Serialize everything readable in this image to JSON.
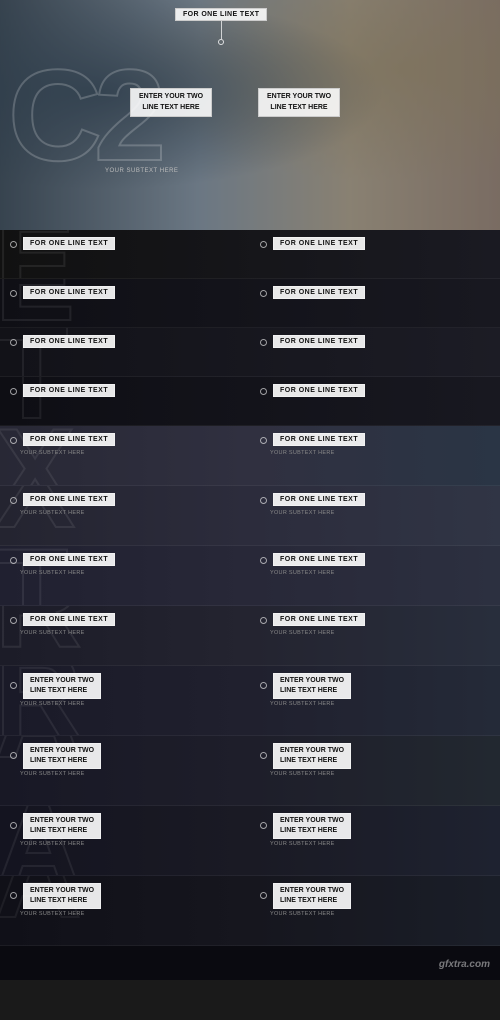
{
  "hero": {
    "top_anno": "FOR ONE LINE TEXT",
    "anno2_line1": "ENTER YOUR TWO",
    "anno2_line2": "LINE TEXT HERE",
    "anno3_line1": "ENTER YOUR TWO",
    "anno3_line2": "LINE TEXT HERE",
    "sub1": "YOUR SUBTEXT HERE",
    "big_letters": "C2"
  },
  "rows": [
    {
      "id": "row1",
      "left": {
        "title": "FOR ONE LINE TEXT",
        "style": "simple",
        "dot": true
      },
      "right": {
        "title": "FOR ONE LINE TEXT",
        "style": "simple",
        "dot": true
      }
    },
    {
      "id": "row2",
      "left": {
        "title": "FOR ONE LINE TEXT",
        "style": "simple",
        "dot": true
      },
      "right": {
        "title": "FOR ONE LINE TEXT",
        "style": "simple",
        "dot": true
      }
    },
    {
      "id": "row3",
      "left": {
        "title": "FOR ONE LINE TEXT",
        "style": "simple",
        "dot": true
      },
      "right": {
        "title": "FOR ONE LINE TEXT",
        "style": "simple",
        "dot": true
      }
    },
    {
      "id": "row4",
      "left": {
        "title": "FOR ONE LINE TEXT",
        "style": "simple",
        "dot": true
      },
      "right": {
        "title": "FOR ONE LINE TEXT",
        "style": "simple",
        "dot": true
      }
    },
    {
      "id": "row5",
      "left": {
        "title": "FOR ONE LINE TEXT",
        "sub": "YOUR SUBTEXT HERE",
        "style": "with-sub",
        "dot": true
      },
      "right": {
        "title": "FOR ONE LINE TEXT",
        "sub": "YOUR SUBTEXT HERE",
        "style": "with-sub",
        "dot": true
      }
    },
    {
      "id": "row6",
      "left": {
        "title": "FOR ONE LINE TEXT",
        "sub": "YOUR SUBTEXT HERE",
        "style": "with-sub",
        "dot": true
      },
      "right": {
        "title": "FOR ONE LINE TEXT",
        "sub": "YOUR SUBTEXT HERE",
        "style": "with-sub",
        "dot": true
      }
    },
    {
      "id": "row7",
      "left": {
        "title": "FOR ONE LINE TEXT",
        "sub": "YOUR SUBTEXT HERE",
        "style": "with-sub",
        "dot": true
      },
      "right": {
        "title": "FOR ONE LINE TEXT",
        "sub": "YOUR SUBTEXT HERE",
        "style": "with-sub",
        "dot": true
      }
    },
    {
      "id": "row8",
      "left": {
        "title": "FOR ONE LINE TEXT",
        "sub": "YOUR SUBTEXT HERE",
        "style": "with-sub",
        "dot": true
      },
      "right": {
        "title": "FOR ONE LINE TEXT",
        "sub": "YOUR SUBTEXT HERE",
        "style": "with-sub",
        "dot": true
      }
    },
    {
      "id": "row9",
      "left": {
        "line1": "ENTER YOUR TWO",
        "line2": "LINE TEXT HERE",
        "sub": "YOUR SUBTEXT HERE",
        "style": "two-line",
        "dot": true
      },
      "right": {
        "line1": "ENTER YOUR TWO",
        "line2": "LINE TEXT HERE",
        "sub": "YOUR SUBTEXT HERE",
        "style": "two-line",
        "dot": true
      }
    },
    {
      "id": "row10",
      "left": {
        "line1": "ENTER YOUR TWO",
        "line2": "LINE TEXT HERE",
        "sub": "YOUR SUBTEXT HERE",
        "style": "two-line",
        "dot": true
      },
      "right": {
        "line1": "ENTER YOUR TWO",
        "line2": "LINE TEXT HERE",
        "sub": "YOUR SUBTEXT HERE",
        "style": "two-line",
        "dot": true
      }
    },
    {
      "id": "row11",
      "left": {
        "line1": "ENTER YOUR TWO",
        "line2": "LINE TEXT HERE",
        "sub": "YOUR SUBTEXT HERE",
        "style": "two-line",
        "dot": true
      },
      "right": {
        "line1": "ENTER YOUR TWO",
        "line2": "LINE TEXT HERE",
        "sub": "YOUR SUBTEXT HERE",
        "style": "two-line",
        "dot": true
      }
    },
    {
      "id": "row12",
      "left": {
        "line1": "ENTER YOUR TWO",
        "line2": "LINE TEXT HERE",
        "sub": "YOUR SUBTEXT HERE",
        "style": "two-line",
        "dot": true
      },
      "right": {
        "line1": "ENTER YOUR TWO",
        "line2": "LINE TEXT HERE",
        "sub": "YOUR SUBTEXT HERE",
        "style": "two-line",
        "dot": true
      }
    }
  ],
  "big_letters": [
    "E",
    "T",
    "X",
    "T",
    "R",
    "A"
  ],
  "watermark": "gfxtra.com",
  "colors": {
    "bg": "#0e0e0e",
    "text_white": "#ffffff",
    "text_gray": "#888888",
    "border": "rgba(255,255,255,0.4)"
  }
}
